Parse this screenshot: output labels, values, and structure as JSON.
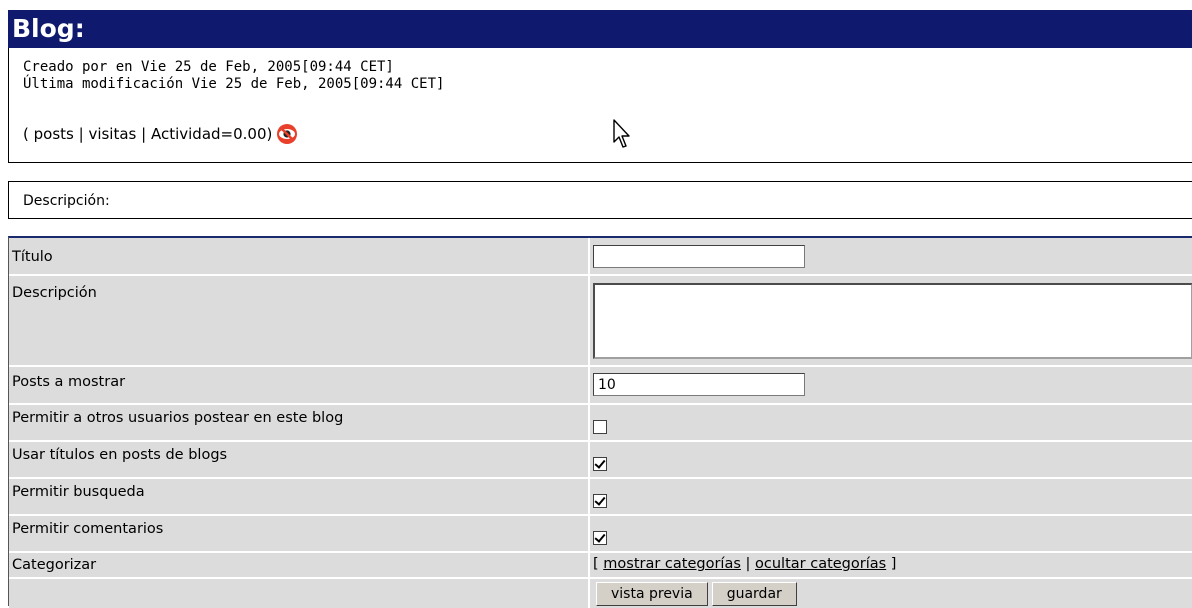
{
  "header": {
    "title": "Blog:"
  },
  "info": {
    "created": "Creado por en Vie 25 de Feb, 2005[09:44 CET]",
    "modified": "Última modificación Vie 25 de Feb, 2005[09:44 CET]",
    "stats_prefix": "( ",
    "posts_link": "posts",
    "sep1": " | ",
    "visits_link": "visitas",
    "sep2": " | ",
    "activity": "Actividad=0.00)"
  },
  "description_section": {
    "label": "Descripción:"
  },
  "form": {
    "title_label": "Título",
    "title_value": "",
    "description_label": "Descripción",
    "description_value": "",
    "posts_label": "Posts a mostrar",
    "posts_value": "10",
    "allow_others_label": "Permitir a otros usuarios postear en este blog",
    "allow_others_checked": false,
    "use_titles_label": "Usar títulos en posts de blogs",
    "use_titles_checked": true,
    "allow_search_label": "Permitir busqueda",
    "allow_search_checked": true,
    "allow_comments_label": "Permitir comentarios",
    "allow_comments_checked": true,
    "categorize_label": "Categorizar",
    "cat_open": "[ ",
    "show_categories": "mostrar categorías",
    "cat_sep": " | ",
    "hide_categories": "ocultar categorías",
    "cat_close": " ]",
    "preview_button": "vista previa",
    "save_button": "guardar"
  },
  "colors": {
    "header_bg": "#0f1a6e",
    "row_bg": "#dcdcdc"
  },
  "icons": {
    "monitor": "eye-icon",
    "cursor": "arrow-cursor-icon"
  }
}
